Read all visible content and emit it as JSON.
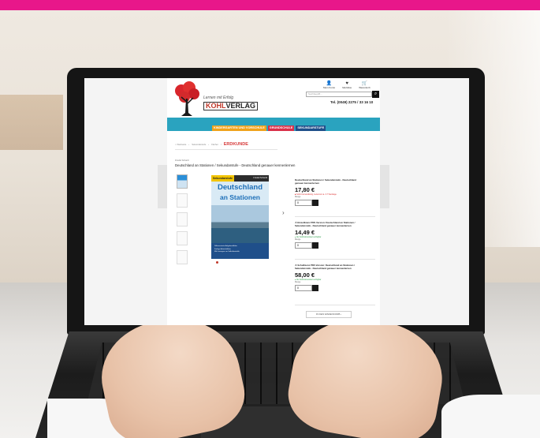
{
  "header": {
    "slogan": "Lernen mit Erfolg",
    "logo_text_a": "KOHL",
    "logo_text_b": "VERLAG",
    "icons": [
      {
        "icon": "user-icon",
        "label": "Mein Konto"
      },
      {
        "icon": "heart-icon",
        "label": "Merkliste"
      },
      {
        "icon": "cart-icon",
        "label": "Warenkorb"
      }
    ],
    "search_placeholder": "Suchbegriff...",
    "phone": "Tel. (0049) 2275 / 33 16 10"
  },
  "nav": {
    "tabs": [
      {
        "label": "KINDERGARTEN UND VORSCHULE",
        "color": "#f0a21c"
      },
      {
        "label": "GRUNDSCHULE",
        "color": "#d9304a"
      },
      {
        "label": "SEKUNDARSTUFE",
        "color": "#1f4f8a"
      }
    ]
  },
  "breadcrumb": {
    "items": [
      "Startseite",
      "Sekundarstufe",
      "Fächer",
      "ERDKUNDE"
    ]
  },
  "product": {
    "publisher": "Friedel Schardt",
    "title": "Deutschland an Stationen / Sekundarstufe - Deutschland genauer kennenlernen",
    "cover": {
      "badge": "Sekundarstufe",
      "author": "Friedel Schardt",
      "title_line1": "Deutschland",
      "title_line2": "an Stationen",
      "bullets": [
        "Differenzierte Aufgabenblätter",
        "Farbige Arbeitsblätter",
        "Mit Lösungen zur Selbstkontrolle"
      ]
    },
    "options": [
      {
        "name_line1": "Deutschland an Stationen / Sekundarstufe - Deutschland",
        "name_line2": "genauer kennenlernen",
        "price": "17,80 €",
        "stock": "Sofort versandfertig, Lieferzeit ca. 3-7 Werktage",
        "stock_color": "red",
        "qty_label": "Menge",
        "qty": "0"
      },
      {
        "name_line1": "⚠ Einzellizenz PDF-Version: Deutschland an Stationen /",
        "name_line2": "Sekundarstufe - Deutschland genauer kennenlernen",
        "price": "14,49 €",
        "stock": "Als Sofortdownload verfügbar",
        "stock_color": "green",
        "qty_label": "Menge",
        "qty": "0"
      },
      {
        "name_line1": "⚠ Schullizenz PDF-Version: Deutschland an Stationen /",
        "name_line2": "Sekundarstufe - Deutschland genauer kennenlernen",
        "price": "58,00 €",
        "stock": "Als Sofortdownload verfügbar",
        "stock_color": "green",
        "qty_label": "Menge",
        "qty": "0"
      }
    ],
    "cart_button": "IN DEN WARENKORB"
  }
}
